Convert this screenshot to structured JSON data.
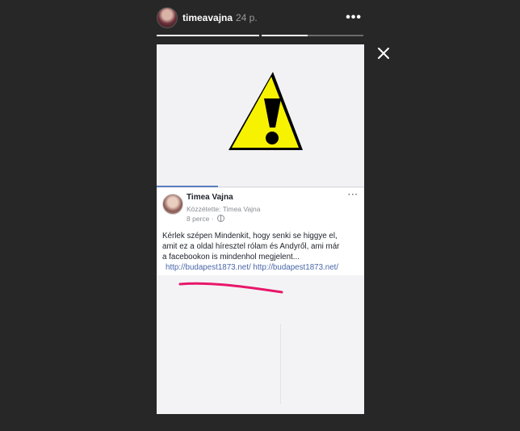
{
  "story": {
    "username": "timeavajna",
    "time": "24 p.",
    "icons": {
      "avatar": "profile-avatar",
      "more": "more-options-icon",
      "close": "close-icon",
      "warning": "warning-triangle-icon"
    }
  },
  "progress": [
    1.0,
    0.45
  ],
  "post": {
    "author": "Timea Vajna",
    "shared_by": "Közzétette: Timea Vajna",
    "time": "8 perce · ",
    "more": "···",
    "text_lines": [
      "Kérlek szépen Mindenkit, hogy senki se higgye el,",
      "amit ez a oldal híresztel rólam és Andyről, ami már",
      "a facebookon is mindenhol megjelent..."
    ],
    "links": [
      "http://budapest1873.net/",
      "http://budapest1873.net/"
    ]
  },
  "colors": {
    "background": "#272727",
    "warning_yellow": "#f7f300",
    "link": "#4a67a8",
    "annotation": "#e8176a"
  }
}
